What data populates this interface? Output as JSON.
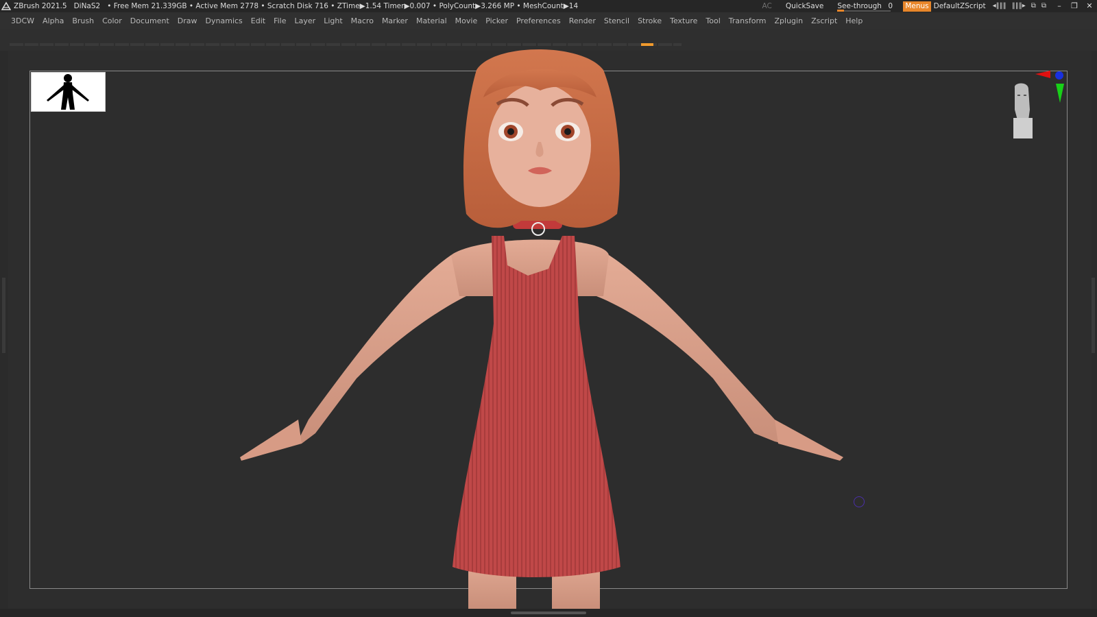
{
  "titlebar": {
    "app_name": "ZBrush 2021.5",
    "project": "DiNaS2",
    "stats": "• Free Mem 21.339GB • Active Mem 2778 • Scratch Disk 716 • ZTime▶1.54 Timer▶0.007 • PolyCount▶3.266 MP • MeshCount▶14",
    "ac_label": "AC",
    "quicksave_label": "QuickSave",
    "seethrough_label": "See-through",
    "seethrough_value": "0",
    "menus_label": "Menus",
    "default_zscript_label": "DefaultZScript"
  },
  "menubar": {
    "items": [
      "3DCW",
      "Alpha",
      "Brush",
      "Color",
      "Document",
      "Draw",
      "Dynamics",
      "Edit",
      "File",
      "Layer",
      "Light",
      "Macro",
      "Marker",
      "Material",
      "Movie",
      "Picker",
      "Preferences",
      "Render",
      "Stencil",
      "Stroke",
      "Texture",
      "Tool",
      "Transform",
      "Zplugin",
      "Zscript",
      "Help"
    ]
  },
  "colors": {
    "accent": "#e8862a",
    "background": "#2b2b2b",
    "dress": "#c24a4a",
    "skin": "#d9a08a",
    "hair": "#c96b45"
  },
  "icons": {
    "logo": "zbrush-logo-icon",
    "gizmo_head": "gizmo-head-icon",
    "axis_gizmo": "axis-gizmo-icon"
  }
}
